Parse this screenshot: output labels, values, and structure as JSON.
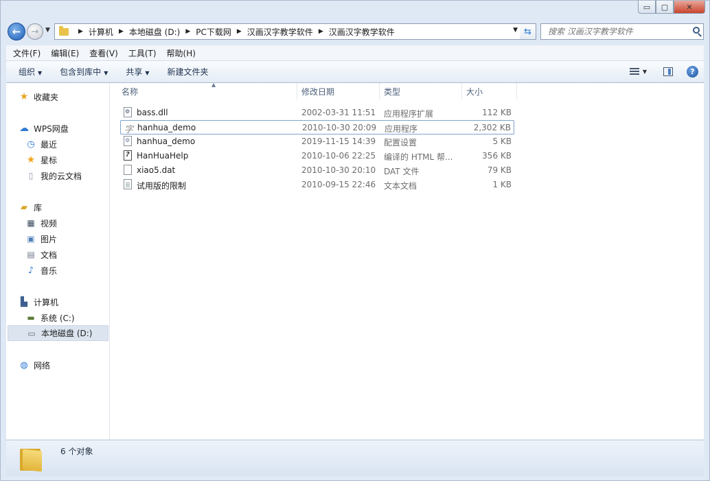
{
  "window": {
    "controls": {
      "minimize": "▭",
      "maximize": "▢",
      "close": "✕"
    }
  },
  "nav": {
    "breadcrumb": [
      "计算机",
      "本地磁盘 (D:)",
      "PC下载网",
      "汉画汉字教学软件",
      "汉画汉字教学软件"
    ],
    "search_placeholder": "搜索 汉画汉字教学软件"
  },
  "menubar": [
    "文件(F)",
    "编辑(E)",
    "查看(V)",
    "工具(T)",
    "帮助(H)"
  ],
  "toolbar": {
    "organize": "组织",
    "include_library": "包含到库中",
    "share": "共享",
    "new_folder": "新建文件夹"
  },
  "sidebar": {
    "favorites": "收藏夹",
    "wps": "WPS网盘",
    "wps_items": [
      "最近",
      "星标",
      "我的云文档"
    ],
    "library": "库",
    "library_items": [
      "视频",
      "图片",
      "文档",
      "音乐"
    ],
    "computer": "计算机",
    "drives": [
      "系统 (C:)",
      "本地磁盘 (D:)"
    ],
    "network": "网络"
  },
  "columns": {
    "name": "名称",
    "date": "修改日期",
    "type": "类型",
    "size": "大小"
  },
  "files": [
    {
      "name": "bass.dll",
      "date": "2002-03-31 11:51",
      "type": "应用程序扩展",
      "size": "112 KB",
      "icon": "dll-icon"
    },
    {
      "name": "hanhua_demo",
      "date": "2010-10-30 20:09",
      "type": "应用程序",
      "size": "2,302 KB",
      "icon": "exe-icon"
    },
    {
      "name": "hanhua_demo",
      "date": "2019-11-15 14:39",
      "type": "配置设置",
      "size": "5 KB",
      "icon": "config-icon"
    },
    {
      "name": "HanHuaHelp",
      "date": "2010-10-06 22:25",
      "type": "编译的 HTML 帮...",
      "size": "356 KB",
      "icon": "chm-icon"
    },
    {
      "name": "xiao5.dat",
      "date": "2010-10-30 20:10",
      "type": "DAT 文件",
      "size": "79 KB",
      "icon": "file-icon"
    },
    {
      "name": "试用版的限制",
      "date": "2010-09-15 22:46",
      "type": "文本文档",
      "size": "1 KB",
      "icon": "text-file-icon"
    }
  ],
  "status": {
    "count_text": "6 个对象"
  },
  "colors": {
    "accent": "#2f7ad2",
    "selection": "#dce5ef",
    "chrome": "#dfe9f5"
  }
}
